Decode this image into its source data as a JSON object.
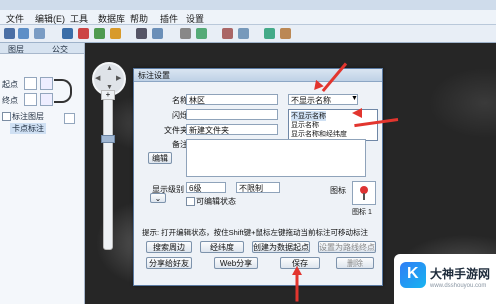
{
  "menu": {
    "items": [
      "文件",
      "编辑(E)",
      "工具",
      "数据库",
      "帮助",
      "插件",
      "设置"
    ]
  },
  "left_panel": {
    "title": "图层",
    "tab_right": "公交",
    "row1_label": "起点",
    "row2_label": "终点",
    "tree_root": "标注图层",
    "tree_child": "卡点标注"
  },
  "dialog": {
    "title": "标注设置",
    "name_label": "名称",
    "name_value": "林区",
    "type_label": "闪烁",
    "folder_label": "文件夹",
    "folder_value": "新建文件夹",
    "note_label": "备注",
    "edit_button": "编辑",
    "display_level_label": "显示级别",
    "display_level_value": "6级",
    "limit_value": "不限制",
    "edit_lock_label": "可编辑状态",
    "icon_label": "图标",
    "icon_count": "图标 1",
    "hint": "提示: 打开编辑状态，按住Shift键+鼠标左键拖动当前标注可移动标注",
    "combo_selected": "不显示名称",
    "dropdown_options": [
      "不显示名称",
      "显示名称",
      "显示名称和经纬度"
    ],
    "buttons_row1": [
      "搜索周边",
      "经纬度",
      "创建为数据起点",
      "设置为路线终点"
    ],
    "buttons_row2": [
      "分享给好友",
      "Web分享",
      "保存",
      "删除"
    ]
  },
  "watermark": {
    "icon_letter": "K",
    "name": "大神手游网",
    "url": "www.dsshouyou.com"
  },
  "colors": {
    "arrow": "#e2352e",
    "accent": "#2f7df6"
  }
}
